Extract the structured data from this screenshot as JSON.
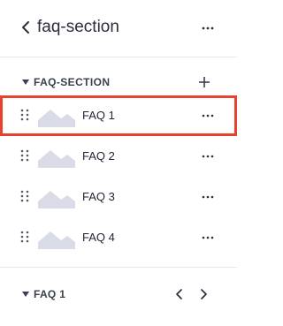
{
  "header": {
    "title": "faq-section",
    "back_icon": "chevron-left-icon",
    "menu_icon": "more-horizontal-icon"
  },
  "section": {
    "label": "FAQ-SECTION",
    "expand_icon": "caret-down-icon",
    "add_icon": "plus-icon"
  },
  "items": [
    {
      "label": "FAQ 1",
      "selected": true
    },
    {
      "label": "FAQ 2",
      "selected": false
    },
    {
      "label": "FAQ 3",
      "selected": false
    },
    {
      "label": "FAQ 4",
      "selected": false
    }
  ],
  "footer": {
    "label": "FAQ 1",
    "expand_icon": "caret-down-icon",
    "prev_icon": "chevron-left-icon",
    "next_icon": "chevron-right-icon"
  },
  "colors": {
    "highlight": "#e8412f",
    "thumbnail": "#d9dce6",
    "divider": "#e6e8ed"
  }
}
